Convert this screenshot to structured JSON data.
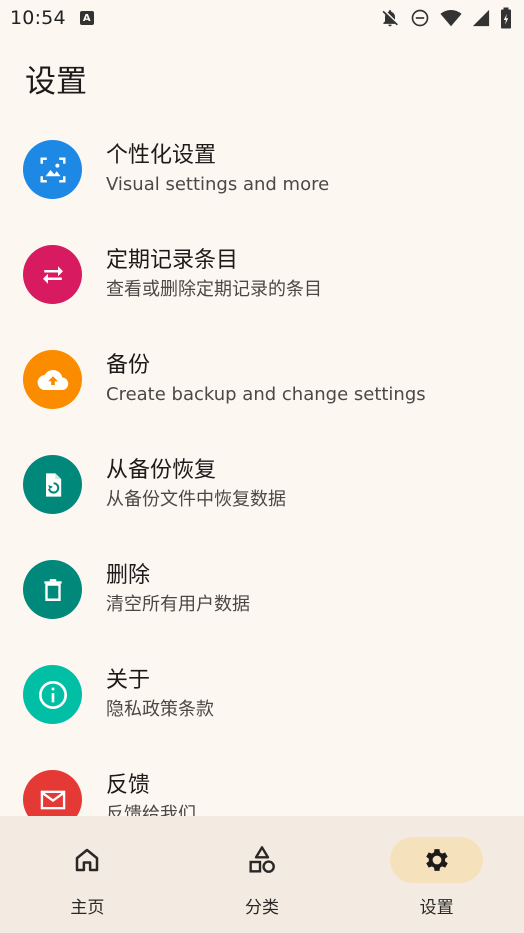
{
  "status_bar": {
    "time": "10:54",
    "app_icon_letter": "A"
  },
  "page": {
    "title": "设置"
  },
  "settings_items": [
    {
      "title": "个性化设置",
      "subtitle": "Visual settings and more",
      "icon": "personalize-icon",
      "color": "#1e88e5"
    },
    {
      "title": "定期记录条目",
      "subtitle": "查看或删除定期记录的条目",
      "icon": "repeat-icon",
      "color": "#d81b60"
    },
    {
      "title": "备份",
      "subtitle": "Create backup and change settings",
      "icon": "cloud-upload-icon",
      "color": "#fb8c00"
    },
    {
      "title": "从备份恢复",
      "subtitle": "从备份文件中恢复数据",
      "icon": "file-restore-icon",
      "color": "#00897b"
    },
    {
      "title": "删除",
      "subtitle": "清空所有用户数据",
      "icon": "trash-icon",
      "color": "#00897b"
    },
    {
      "title": "关于",
      "subtitle": "隐私政策条款",
      "icon": "info-icon",
      "color": "#00bfa5"
    },
    {
      "title": "反馈",
      "subtitle": "反馈给我们",
      "icon": "mail-icon",
      "color": "#e53935"
    }
  ],
  "bottom_nav": {
    "items": [
      {
        "label": "主页",
        "icon": "home-icon",
        "active": false
      },
      {
        "label": "分类",
        "icon": "categories-icon",
        "active": false
      },
      {
        "label": "设置",
        "icon": "gear-icon",
        "active": true
      }
    ],
    "active_pill_color": "#f5e2bd"
  }
}
